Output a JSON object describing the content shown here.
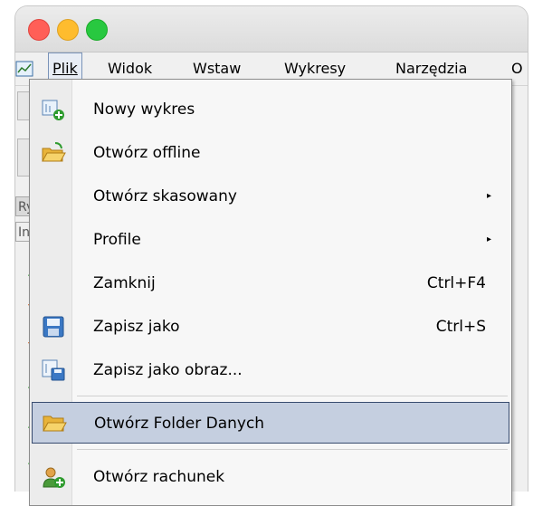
{
  "window": {
    "controls": [
      "close",
      "minimize",
      "zoom"
    ],
    "colors": {
      "close": "#ff5f57",
      "minimize": "#febc2e",
      "zoom": "#28c840"
    }
  },
  "menubar": {
    "items": [
      {
        "label": "Plik",
        "accel_index": 0,
        "active": true
      },
      {
        "label": "Widok",
        "accel_index": 0
      },
      {
        "label": "Wstaw",
        "accel_index": 0
      },
      {
        "label": "Wykresy",
        "accel_index": 0
      },
      {
        "label": "Narzędzia",
        "accel_index": 0
      },
      {
        "label": "O",
        "accel_index": 0
      }
    ]
  },
  "sidebar": {
    "header_labels": [
      "Ry",
      "In"
    ]
  },
  "dropdown": {
    "items": [
      {
        "label": "Nowy wykres",
        "icon": "new-chart-icon"
      },
      {
        "label": "Otwórz offline",
        "icon": "open-folder-icon"
      },
      {
        "label": "Otwórz skasowany",
        "submenu": "▸"
      },
      {
        "label": "Profile",
        "submenu": "▸"
      },
      {
        "label": "Zamknij",
        "shortcut": "Ctrl+F4"
      },
      {
        "label": "Zapisz jako",
        "shortcut": "Ctrl+S",
        "icon": "save-disk-icon"
      },
      {
        "label": "Zapisz jako obraz...",
        "icon": "save-image-icon"
      },
      {
        "label": "Otwórz Folder Danych",
        "icon": "folder-icon",
        "highlighted": true
      },
      {
        "label": "Otwórz rachunek",
        "icon": "account-icon"
      }
    ],
    "highlight_color": "#c5cfe0"
  }
}
